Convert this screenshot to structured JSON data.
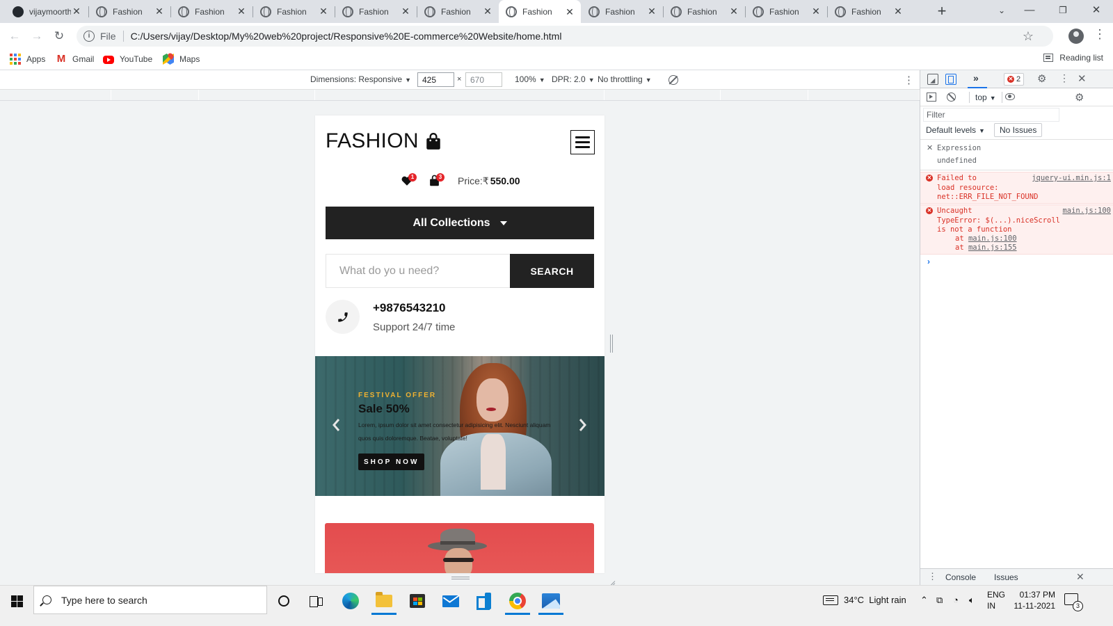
{
  "browser": {
    "tabs": [
      {
        "title": "vijaymoorthy",
        "icon": "github-icon",
        "active": false
      },
      {
        "title": "Fashion",
        "icon": "globe-icon",
        "active": false
      },
      {
        "title": "Fashion",
        "icon": "globe-icon",
        "active": false
      },
      {
        "title": "Fashion",
        "icon": "globe-icon",
        "active": false
      },
      {
        "title": "Fashion",
        "icon": "globe-icon",
        "active": false
      },
      {
        "title": "Fashion",
        "icon": "globe-icon",
        "active": false
      },
      {
        "title": "Fashion",
        "icon": "globe-icon",
        "active": true
      },
      {
        "title": "Fashion",
        "icon": "globe-icon",
        "active": false
      },
      {
        "title": "Fashion",
        "icon": "globe-icon",
        "active": false
      },
      {
        "title": "Fashion",
        "icon": "globe-icon",
        "active": false
      },
      {
        "title": "Fashion",
        "icon": "globe-icon",
        "active": false
      }
    ],
    "address": {
      "scheme": "File",
      "url": "C:/Users/vijay/Desktop/My%20web%20project/Responsive%20E-commerce%20Website/home.html"
    },
    "bookmarks": [
      {
        "label": "Apps",
        "icon": "apps-grid-icon"
      },
      {
        "label": "Gmail",
        "icon": "gmail-icon"
      },
      {
        "label": "YouTube",
        "icon": "youtube-icon"
      },
      {
        "label": "Maps",
        "icon": "maps-icon"
      }
    ],
    "reading_list": "Reading list"
  },
  "device_toolbar": {
    "dimensions": "Dimensions: Responsive",
    "width": "425",
    "height": "670",
    "zoom": "100%",
    "dpr": "DPR: 2.0",
    "throttling": "No throttling"
  },
  "site": {
    "logo": "FASHION",
    "wishlist_count": "1",
    "cart_count": "3",
    "price_label": "Price:₹",
    "price_value": "550.00",
    "collections_label": "All Collections",
    "search_placeholder": "What do yo u need?",
    "search_button": "SEARCH",
    "support_number": "+9876543210",
    "support_text": "Support 24/7 time",
    "banner": {
      "kicker": "FESTIVAL OFFER",
      "title": "Sale 50%",
      "description": "Lorem, ipsum dolor sit amet consectetur adipisicing elit. Nesciunt aliquam quos quis doloremque. Beatae, voluptate!",
      "button": "SHOP NOW"
    }
  },
  "devtools": {
    "more_tabs": "»",
    "error_count": "2",
    "context": "top",
    "filter_placeholder": "Filter",
    "levels": "Default levels",
    "issues": "No Issues",
    "expression_label": "Expression",
    "expression_value": "undefined",
    "errors": [
      {
        "message": "Failed to\nload resource:\nnet::ERR_FILE_NOT_FOUND",
        "source": "jquery-ui.min.js:1"
      },
      {
        "message": "Uncaught\nTypeError: $(...).niceScroll\nis not a function",
        "source": "main.js:100",
        "stack": [
          "main.js:100",
          "main.js:155"
        ],
        "stack_prefix": "at"
      }
    ],
    "drawer_tabs": [
      "Console",
      "Issues"
    ]
  },
  "taskbar": {
    "search_placeholder": "Type here to search",
    "weather": "34°C  Light rain",
    "lang": [
      "ENG",
      "IN"
    ],
    "time": "01:37 PM",
    "date": "11-11-2021",
    "notifications": "3"
  }
}
